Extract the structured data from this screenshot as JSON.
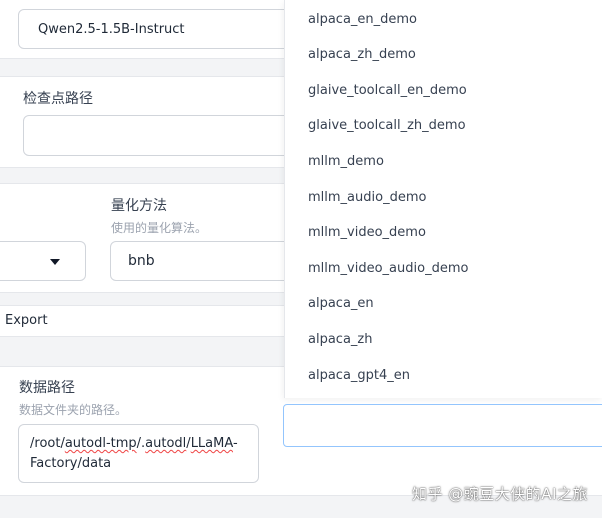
{
  "model_field": {
    "value": "Qwen2.5-1.5B-Instruct"
  },
  "checkpoint_field": {
    "label": "检查点路径",
    "value": ""
  },
  "quantization": {
    "label": "量化方法",
    "hint": "使用的量化算法。",
    "value": "bnb"
  },
  "export_tab": {
    "label": "Export"
  },
  "data_path": {
    "label": "数据路径",
    "hint": "数据文件夹的路径。",
    "value_part1": "/root/",
    "value_part2": "autodl-tmp",
    "value_part3": "/.",
    "value_part4": "autodl",
    "value_part5": "/",
    "value_part6": "LLaMA",
    "value_part7": "-Factory/data"
  },
  "dataset_dropdown": {
    "options": [
      "alpaca_en_demo",
      "alpaca_zh_demo",
      "glaive_toolcall_en_demo",
      "glaive_toolcall_zh_demo",
      "mllm_demo",
      "mllm_audio_demo",
      "mllm_video_demo",
      "mllm_video_audio_demo",
      "alpaca_en",
      "alpaca_zh",
      "alpaca_gpt4_en"
    ],
    "input_value": ""
  },
  "watermark": "知乎 @豌豆大侠的AI之旅",
  "colors": {
    "accent_border": "#93c5fd",
    "spellcheck": "#ef4444"
  }
}
